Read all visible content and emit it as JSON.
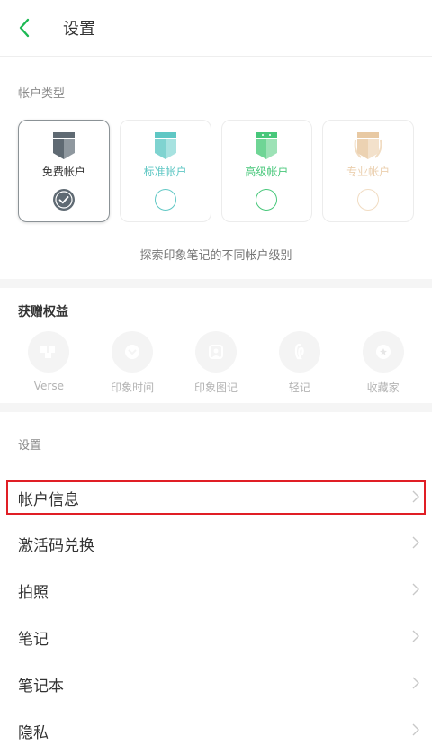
{
  "header": {
    "title": "设置"
  },
  "account": {
    "section_label": "帐户类型",
    "cards": [
      {
        "name": "免费帐户",
        "color": "#5f6a73",
        "selected": true
      },
      {
        "name": "标准帐户",
        "color": "#5fc7c4",
        "selected": false
      },
      {
        "name": "高级帐户",
        "color": "#47c77a",
        "selected": false
      },
      {
        "name": "专业帐户",
        "color": "#e8c9a3",
        "selected": false
      }
    ],
    "explore": "探索印象笔记的不同帐户级别"
  },
  "gifts": {
    "title": "获赠权益",
    "items": [
      {
        "label": "Verse",
        "icon": "verse-icon"
      },
      {
        "label": "印象时间",
        "icon": "time-icon"
      },
      {
        "label": "印象图记",
        "icon": "diagram-icon"
      },
      {
        "label": "轻记",
        "icon": "lightnote-icon"
      },
      {
        "label": "收藏家",
        "icon": "collector-icon"
      }
    ]
  },
  "settings": {
    "section_label": "设置",
    "rows": [
      {
        "label": "帐户信息",
        "highlighted": true
      },
      {
        "label": "激活码兑换"
      },
      {
        "label": "拍照"
      },
      {
        "label": "笔记"
      },
      {
        "label": "笔记本"
      },
      {
        "label": "隐私"
      }
    ]
  },
  "colors": {
    "accent": "#1db954",
    "highlight": "#e01e25"
  }
}
